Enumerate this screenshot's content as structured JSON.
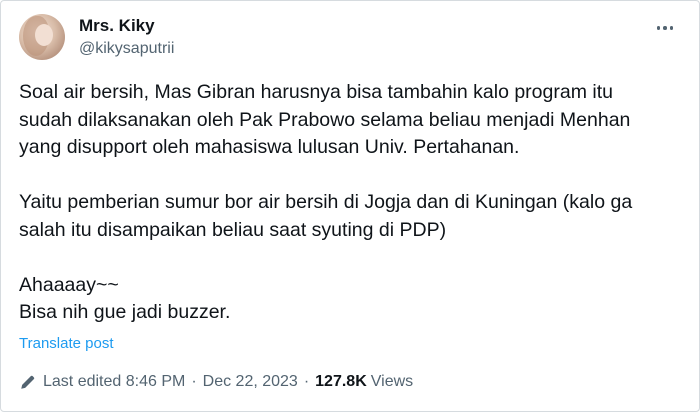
{
  "author": {
    "display_name": "Mrs. Kiky",
    "handle": "@kikysaputrii",
    "avatar_icon": "profile-photo"
  },
  "tweet": {
    "paragraph1": [
      "Soal air bersih, Mas Gibran harusnya bisa tambahin kalo program itu",
      "sudah dilaksanakan oleh Pak Prabowo selama beliau menjadi Menhan",
      "yang disupport oleh mahasiswa lulusan Univ. Pertahanan."
    ],
    "paragraph2": [
      "Yaitu pemberian sumur bor air bersih di Jogja dan di Kuningan (kalo ga",
      "salah itu disampaikan beliau saat syuting di PDP)"
    ],
    "paragraph3": [
      "Ahaaaay~~",
      "Bisa nih gue jadi buzzer."
    ]
  },
  "translate_label": "Translate post",
  "meta": {
    "edited_label": "Last edited 8:46 PM",
    "separator": "·",
    "date": "Dec 22, 2023",
    "views_count": "127.8K",
    "views_label": "Views"
  },
  "colors": {
    "text": "#0f1419",
    "secondary": "#536471",
    "link": "#1d9bf0"
  }
}
